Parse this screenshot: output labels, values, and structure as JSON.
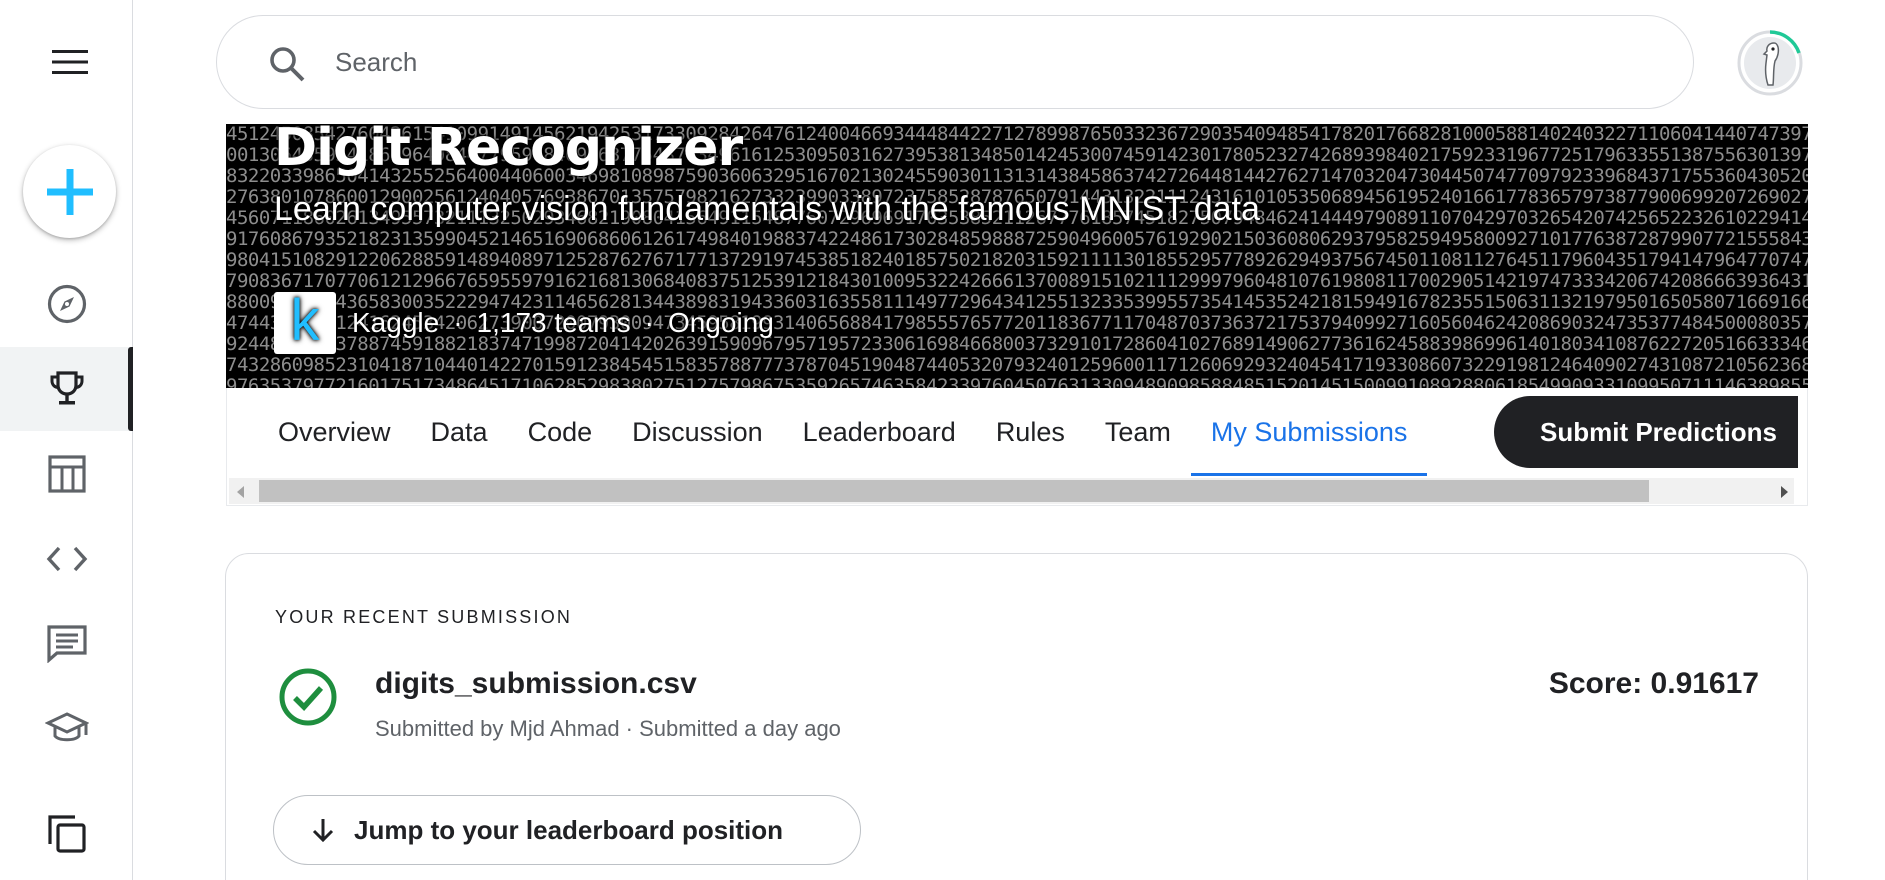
{
  "sidebar": {
    "items": [
      {
        "name": "create",
        "icon": "plus-icon"
      },
      {
        "name": "explore",
        "icon": "compass-icon"
      },
      {
        "name": "competitions",
        "icon": "trophy-icon",
        "active": true
      },
      {
        "name": "datasets",
        "icon": "table-icon"
      },
      {
        "name": "code",
        "icon": "code-icon"
      },
      {
        "name": "discussions",
        "icon": "comment-icon"
      },
      {
        "name": "learn",
        "icon": "school-icon"
      },
      {
        "name": "more",
        "icon": "copy-icon"
      }
    ]
  },
  "search": {
    "placeholder": "Search"
  },
  "banner": {
    "title": "Digit Recognizer",
    "subtitle": "Learn computer vision fundamentals with the famous MNIST data",
    "host": "Kaggle",
    "teams": "1,173 teams",
    "status": "Ongoing",
    "separator": "·",
    "logo_letter": "k"
  },
  "tabs": [
    {
      "label": "Overview",
      "active": false
    },
    {
      "label": "Data",
      "active": false
    },
    {
      "label": "Code",
      "active": false
    },
    {
      "label": "Discussion",
      "active": false
    },
    {
      "label": "Leaderboard",
      "active": false
    },
    {
      "label": "Rules",
      "active": false
    },
    {
      "label": "Team",
      "active": false
    },
    {
      "label": "My Submissions",
      "active": true
    }
  ],
  "submit_button": "Submit Predictions",
  "submission": {
    "section_label": "YOUR RECENT SUBMISSION",
    "file_name": "digits_submission.csv",
    "meta": "Submitted by Mjd Ahmad · Submitted a day ago",
    "score": "Score: 0.91617",
    "jump_label": "Jump to your leaderboard position"
  },
  "colors": {
    "accent": "#1a73e8",
    "kaggle_blue": "#20beff",
    "success": "#1e8e3e",
    "dark": "#202124"
  }
}
